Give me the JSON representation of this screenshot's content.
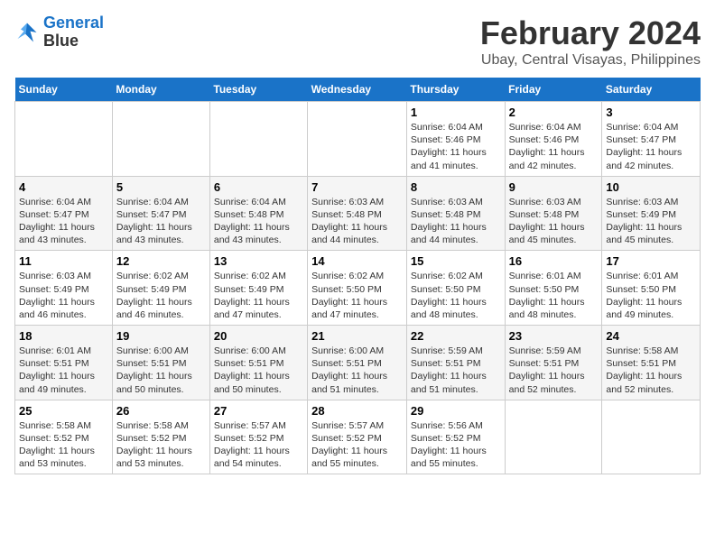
{
  "app": {
    "name_line1": "General",
    "name_line2": "Blue"
  },
  "header": {
    "month": "February 2024",
    "location": "Ubay, Central Visayas, Philippines"
  },
  "weekdays": [
    "Sunday",
    "Monday",
    "Tuesday",
    "Wednesday",
    "Thursday",
    "Friday",
    "Saturday"
  ],
  "weeks": [
    [
      {
        "day": "",
        "info": ""
      },
      {
        "day": "",
        "info": ""
      },
      {
        "day": "",
        "info": ""
      },
      {
        "day": "",
        "info": ""
      },
      {
        "day": "1",
        "info": "Sunrise: 6:04 AM\nSunset: 5:46 PM\nDaylight: 11 hours\nand 41 minutes."
      },
      {
        "day": "2",
        "info": "Sunrise: 6:04 AM\nSunset: 5:46 PM\nDaylight: 11 hours\nand 42 minutes."
      },
      {
        "day": "3",
        "info": "Sunrise: 6:04 AM\nSunset: 5:47 PM\nDaylight: 11 hours\nand 42 minutes."
      }
    ],
    [
      {
        "day": "4",
        "info": "Sunrise: 6:04 AM\nSunset: 5:47 PM\nDaylight: 11 hours\nand 43 minutes."
      },
      {
        "day": "5",
        "info": "Sunrise: 6:04 AM\nSunset: 5:47 PM\nDaylight: 11 hours\nand 43 minutes."
      },
      {
        "day": "6",
        "info": "Sunrise: 6:04 AM\nSunset: 5:48 PM\nDaylight: 11 hours\nand 43 minutes."
      },
      {
        "day": "7",
        "info": "Sunrise: 6:03 AM\nSunset: 5:48 PM\nDaylight: 11 hours\nand 44 minutes."
      },
      {
        "day": "8",
        "info": "Sunrise: 6:03 AM\nSunset: 5:48 PM\nDaylight: 11 hours\nand 44 minutes."
      },
      {
        "day": "9",
        "info": "Sunrise: 6:03 AM\nSunset: 5:48 PM\nDaylight: 11 hours\nand 45 minutes."
      },
      {
        "day": "10",
        "info": "Sunrise: 6:03 AM\nSunset: 5:49 PM\nDaylight: 11 hours\nand 45 minutes."
      }
    ],
    [
      {
        "day": "11",
        "info": "Sunrise: 6:03 AM\nSunset: 5:49 PM\nDaylight: 11 hours\nand 46 minutes."
      },
      {
        "day": "12",
        "info": "Sunrise: 6:02 AM\nSunset: 5:49 PM\nDaylight: 11 hours\nand 46 minutes."
      },
      {
        "day": "13",
        "info": "Sunrise: 6:02 AM\nSunset: 5:49 PM\nDaylight: 11 hours\nand 47 minutes."
      },
      {
        "day": "14",
        "info": "Sunrise: 6:02 AM\nSunset: 5:50 PM\nDaylight: 11 hours\nand 47 minutes."
      },
      {
        "day": "15",
        "info": "Sunrise: 6:02 AM\nSunset: 5:50 PM\nDaylight: 11 hours\nand 48 minutes."
      },
      {
        "day": "16",
        "info": "Sunrise: 6:01 AM\nSunset: 5:50 PM\nDaylight: 11 hours\nand 48 minutes."
      },
      {
        "day": "17",
        "info": "Sunrise: 6:01 AM\nSunset: 5:50 PM\nDaylight: 11 hours\nand 49 minutes."
      }
    ],
    [
      {
        "day": "18",
        "info": "Sunrise: 6:01 AM\nSunset: 5:51 PM\nDaylight: 11 hours\nand 49 minutes."
      },
      {
        "day": "19",
        "info": "Sunrise: 6:00 AM\nSunset: 5:51 PM\nDaylight: 11 hours\nand 50 minutes."
      },
      {
        "day": "20",
        "info": "Sunrise: 6:00 AM\nSunset: 5:51 PM\nDaylight: 11 hours\nand 50 minutes."
      },
      {
        "day": "21",
        "info": "Sunrise: 6:00 AM\nSunset: 5:51 PM\nDaylight: 11 hours\nand 51 minutes."
      },
      {
        "day": "22",
        "info": "Sunrise: 5:59 AM\nSunset: 5:51 PM\nDaylight: 11 hours\nand 51 minutes."
      },
      {
        "day": "23",
        "info": "Sunrise: 5:59 AM\nSunset: 5:51 PM\nDaylight: 11 hours\nand 52 minutes."
      },
      {
        "day": "24",
        "info": "Sunrise: 5:58 AM\nSunset: 5:51 PM\nDaylight: 11 hours\nand 52 minutes."
      }
    ],
    [
      {
        "day": "25",
        "info": "Sunrise: 5:58 AM\nSunset: 5:52 PM\nDaylight: 11 hours\nand 53 minutes."
      },
      {
        "day": "26",
        "info": "Sunrise: 5:58 AM\nSunset: 5:52 PM\nDaylight: 11 hours\nand 53 minutes."
      },
      {
        "day": "27",
        "info": "Sunrise: 5:57 AM\nSunset: 5:52 PM\nDaylight: 11 hours\nand 54 minutes."
      },
      {
        "day": "28",
        "info": "Sunrise: 5:57 AM\nSunset: 5:52 PM\nDaylight: 11 hours\nand 55 minutes."
      },
      {
        "day": "29",
        "info": "Sunrise: 5:56 AM\nSunset: 5:52 PM\nDaylight: 11 hours\nand 55 minutes."
      },
      {
        "day": "",
        "info": ""
      },
      {
        "day": "",
        "info": ""
      }
    ]
  ]
}
